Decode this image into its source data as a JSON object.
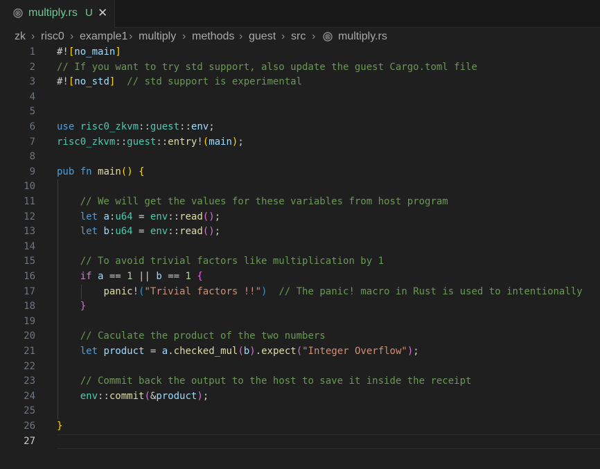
{
  "tab": {
    "filename": "multiply.rs",
    "status": "U",
    "close_glyph": "✕",
    "icon": "rust-file-icon"
  },
  "breadcrumb": {
    "items": [
      "zk",
      "risc0",
      "example1",
      "multiply",
      "methods",
      "guest",
      "src",
      "multiply.rs"
    ],
    "separator": "›"
  },
  "editor": {
    "active_line": 27,
    "lines": [
      {
        "n": "1",
        "text": "#![no_main]"
      },
      {
        "n": "2",
        "text": "// If you want to try std support, also update the guest Cargo.toml file"
      },
      {
        "n": "3",
        "text": "#![no_std]  // std support is experimental"
      },
      {
        "n": "4",
        "text": ""
      },
      {
        "n": "5",
        "text": ""
      },
      {
        "n": "6",
        "text": "use risc0_zkvm::guest::env;"
      },
      {
        "n": "7",
        "text": "risc0_zkvm::guest::entry!(main);"
      },
      {
        "n": "8",
        "text": ""
      },
      {
        "n": "9",
        "text": "pub fn main() {"
      },
      {
        "n": "10",
        "text": ""
      },
      {
        "n": "11",
        "text": "    // We will get the values for these variables from host program"
      },
      {
        "n": "12",
        "text": "    let a:u64 = env::read();"
      },
      {
        "n": "13",
        "text": "    let b:u64 = env::read();"
      },
      {
        "n": "14",
        "text": ""
      },
      {
        "n": "15",
        "text": "    // To avoid trivial factors like multiplication by 1"
      },
      {
        "n": "16",
        "text": "    if a == 1 || b == 1 {"
      },
      {
        "n": "17",
        "text": "        panic!(\"Trivial factors !!\")  // The panic! macro in Rust is used to intentionally"
      },
      {
        "n": "18",
        "text": "    }"
      },
      {
        "n": "19",
        "text": ""
      },
      {
        "n": "20",
        "text": "    // Caculate the product of the two numbers"
      },
      {
        "n": "21",
        "text": "    let product = a.checked_mul(b).expect(\"Integer Overflow\");"
      },
      {
        "n": "22",
        "text": ""
      },
      {
        "n": "23",
        "text": "    // Commit back the output to the host to save it inside the receipt"
      },
      {
        "n": "24",
        "text": "    env::commit(&product);"
      },
      {
        "n": "25",
        "text": ""
      },
      {
        "n": "26",
        "text": "}"
      },
      {
        "n": "27",
        "text": ""
      }
    ]
  },
  "colors": {
    "background": "#1f1f1f",
    "tab_text": "#73c991",
    "keyword": "#569cd6",
    "comment": "#6a9955",
    "string": "#ce9178",
    "number": "#b5cea8",
    "function": "#dcdcaa",
    "type": "#4ec9b0",
    "variable": "#9cdcfe",
    "bracket_1": "#ffd700",
    "bracket_2": "#da70d6"
  }
}
